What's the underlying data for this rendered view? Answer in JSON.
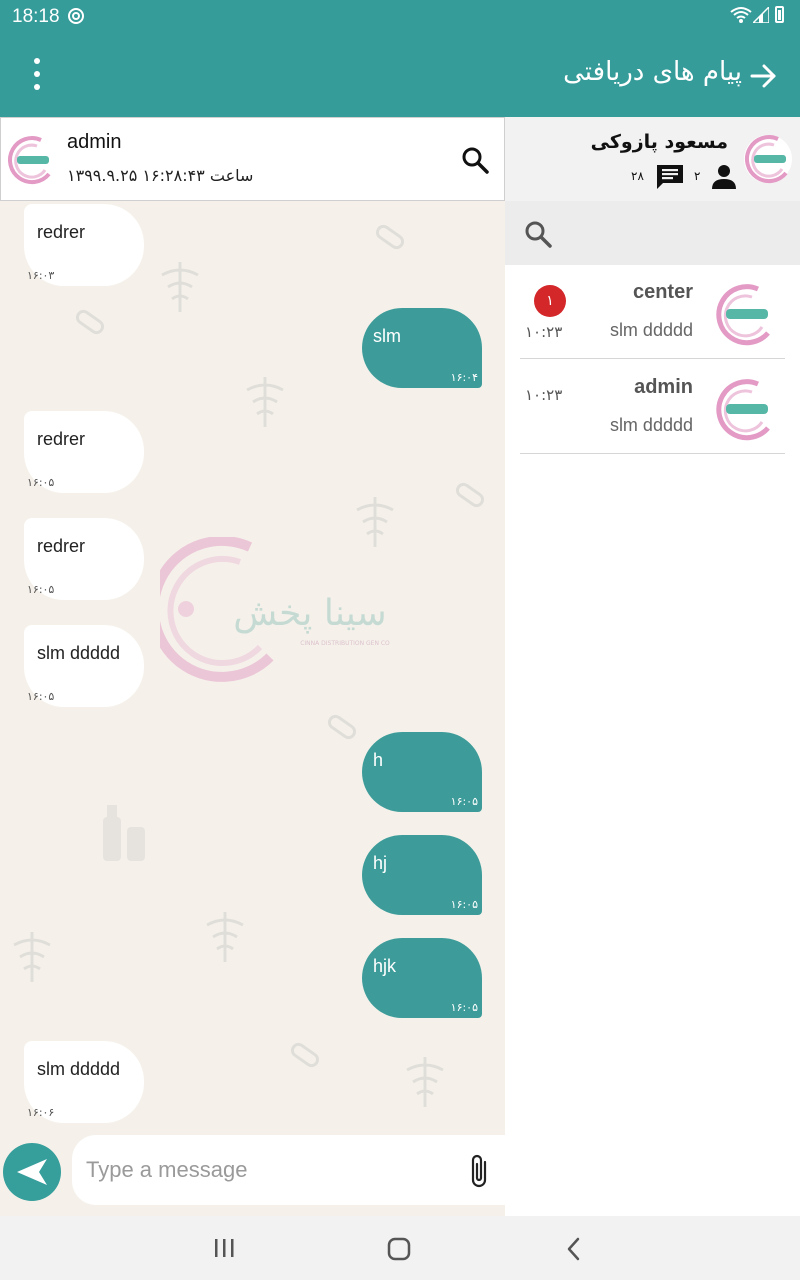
{
  "status_bar": {
    "time": "18:18"
  },
  "app_bar": {
    "title": "پیام های دریافتی"
  },
  "chat_header": {
    "name": "admin",
    "last_seen": "۱۳۹۹.۹.۲۵ ساعت ۱۶:۲۸:۴۳"
  },
  "messages": [
    {
      "dir": "in",
      "text": "redrer",
      "time": "۱۶:۰۳"
    },
    {
      "dir": "out",
      "text": "slm",
      "time": "۱۶:۰۴"
    },
    {
      "dir": "in",
      "text": "redrer",
      "time": "۱۶:۰۵"
    },
    {
      "dir": "in",
      "text": "redrer",
      "time": "۱۶:۰۵"
    },
    {
      "dir": "in",
      "text": "slm ddddd",
      "time": "۱۶:۰۵"
    },
    {
      "dir": "out",
      "text": "h",
      "time": "۱۶:۰۵"
    },
    {
      "dir": "out",
      "text": "hj",
      "time": "۱۶:۰۵"
    },
    {
      "dir": "out",
      "text": "hjk",
      "time": "۱۶:۰۵"
    },
    {
      "dir": "in",
      "text": "slm ddddd",
      "time": "۱۶:۰۶"
    }
  ],
  "composer": {
    "placeholder": "Type a message"
  },
  "profile": {
    "name": "مسعود پازوکی",
    "user_count": "۲",
    "message_count": "۲۸"
  },
  "conversations": [
    {
      "name": "center",
      "preview": "slm ddddd",
      "time": "۱۰:۲۳",
      "unread": "۱"
    },
    {
      "name": "admin",
      "preview": "slm ddddd",
      "time": "۱۰:۲۳",
      "unread": ""
    }
  ],
  "watermark": {
    "brand_text": "سینا پخش",
    "brand_sub": "CINNA DISTRIBUTION GEN CO"
  },
  "colors": {
    "primary": "#359c9a",
    "bubble_out": "#3d9c9a",
    "badge": "#d3272a",
    "chat_bg": "#f5f1ea"
  },
  "icons": [
    "menu-icon",
    "back-arrow-icon",
    "search-icon",
    "user-icon",
    "chat-icon",
    "send-icon",
    "attach-icon"
  ]
}
